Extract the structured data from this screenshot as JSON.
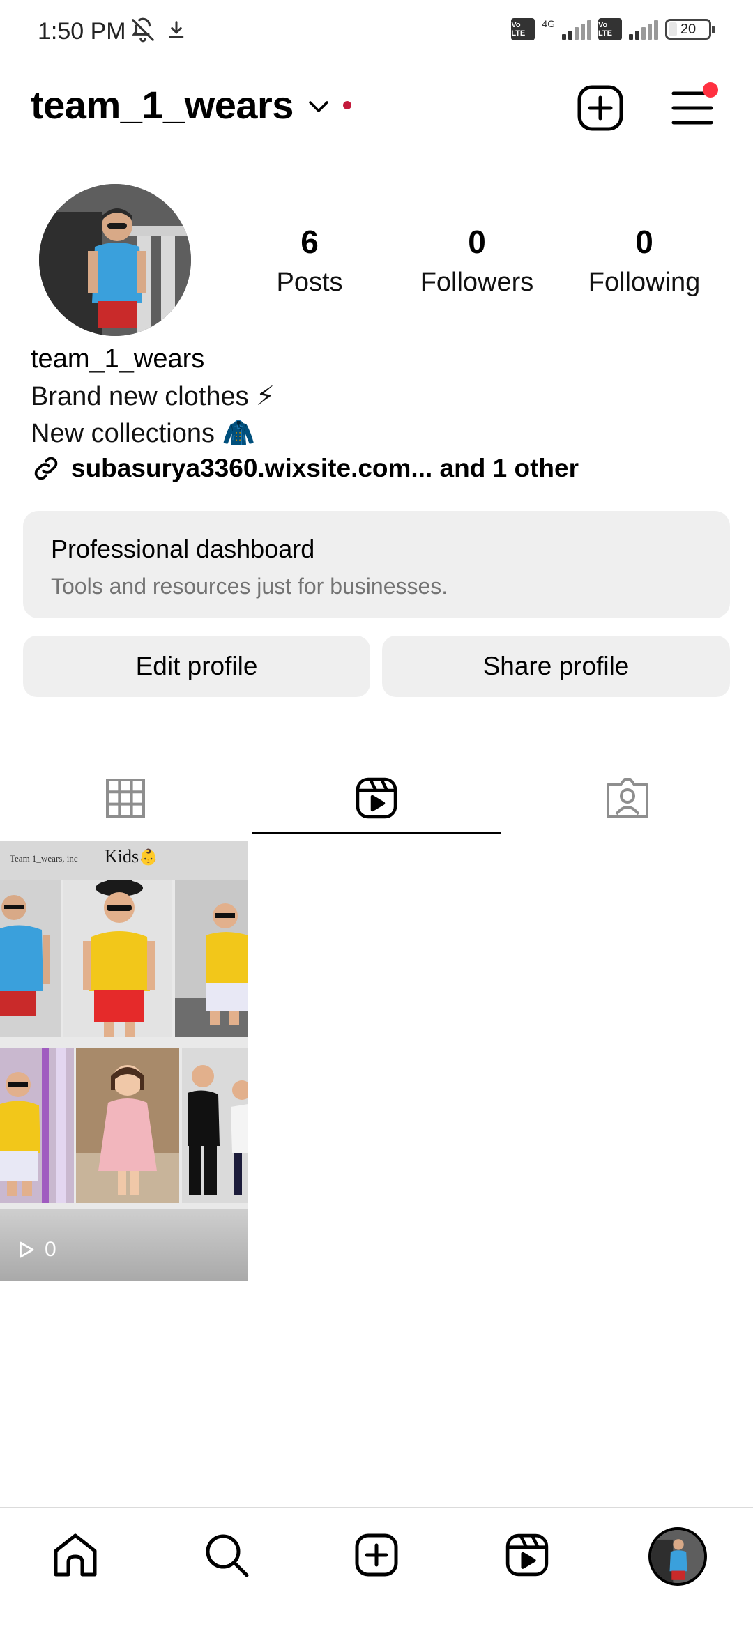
{
  "status_bar": {
    "time": "1:50 PM",
    "network_label": "4G",
    "volte_label": "Vo LTE",
    "battery": "20",
    "battery_level": 0.2
  },
  "header": {
    "username": "team_1_wears"
  },
  "profile": {
    "stats": [
      {
        "value": "6",
        "label": "Posts"
      },
      {
        "value": "0",
        "label": "Followers"
      },
      {
        "value": "0",
        "label": "Following"
      }
    ],
    "name": "team_1_wears",
    "bio_lines": [
      "Brand new clothes ⚡",
      "New collections 🧥"
    ],
    "link_text": "subasurya3360.wixsite.com... and 1 other"
  },
  "dashboard": {
    "title": "Professional dashboard",
    "subtitle": "Tools and resources just for businesses."
  },
  "buttons": {
    "edit_profile": "Edit profile",
    "share_profile": "Share profile"
  },
  "reel": {
    "brand": "Team 1_wears, inc",
    "title": "Kids",
    "emoji": "👶",
    "views": "0"
  },
  "colors": {
    "accent_red": "#ff3040",
    "dot_red": "#c41a3b",
    "surface": "#efefef",
    "muted_text": "#737373"
  }
}
